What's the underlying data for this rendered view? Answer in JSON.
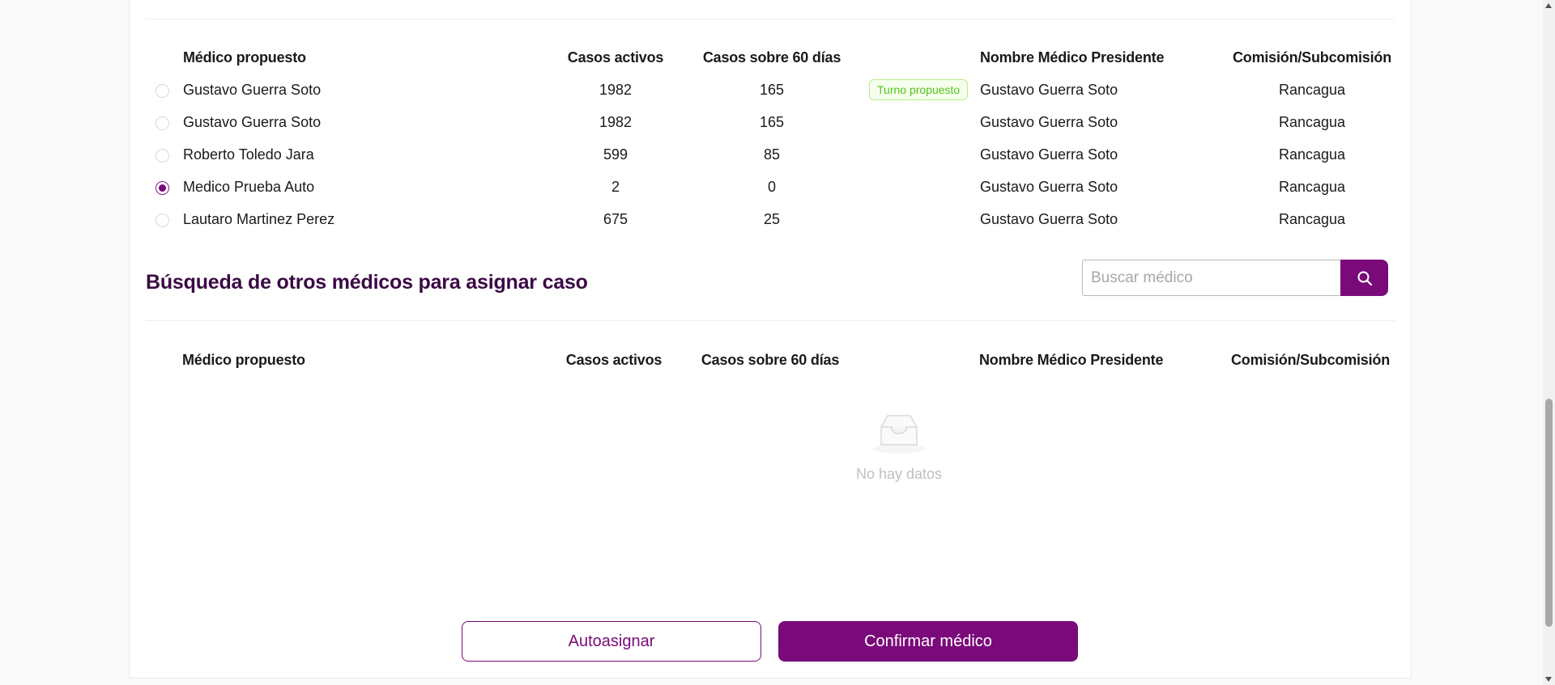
{
  "table_headers": {
    "name": "Médico propuesto",
    "active": "Casos activos",
    "over60": "Casos sobre 60 días",
    "president": "Nombre Médico Presidente",
    "commission": "Comisión/Subcomisión"
  },
  "proposed_rows": [
    {
      "name": "Gustavo Guerra Soto",
      "active": "1982",
      "over60": "165",
      "badge": "Turno propuesto",
      "president": "Gustavo Guerra Soto",
      "commission": "Rancagua",
      "selected": false
    },
    {
      "name": "Gustavo Guerra Soto",
      "active": "1982",
      "over60": "165",
      "badge": "",
      "president": "Gustavo Guerra Soto",
      "commission": "Rancagua",
      "selected": false
    },
    {
      "name": "Roberto Toledo Jara",
      "active": "599",
      "over60": "85",
      "badge": "",
      "president": "Gustavo Guerra Soto",
      "commission": "Rancagua",
      "selected": false
    },
    {
      "name": "Medico Prueba Auto",
      "active": "2",
      "over60": "0",
      "badge": "",
      "president": "Gustavo Guerra Soto",
      "commission": "Rancagua",
      "selected": true
    },
    {
      "name": "Lautaro Martinez Perez",
      "active": "675",
      "over60": "25",
      "badge": "",
      "president": "Gustavo Guerra Soto",
      "commission": "Rancagua",
      "selected": false
    }
  ],
  "search_section": {
    "title": "Búsqueda de otros médicos para asignar caso",
    "placeholder": "Buscar médico",
    "value": "",
    "search_icon": "search-icon"
  },
  "empty_state": {
    "icon": "inbox-icon",
    "text": "No hay datos"
  },
  "buttons": {
    "autoassign": "Autoasignar",
    "confirm": "Confirmar médico"
  },
  "colors": {
    "primary": "#7a0a7a",
    "title": "#3b0a45",
    "badge_text": "#52c41a",
    "badge_bg": "#f6ffed",
    "badge_border": "#b7eb8f"
  }
}
